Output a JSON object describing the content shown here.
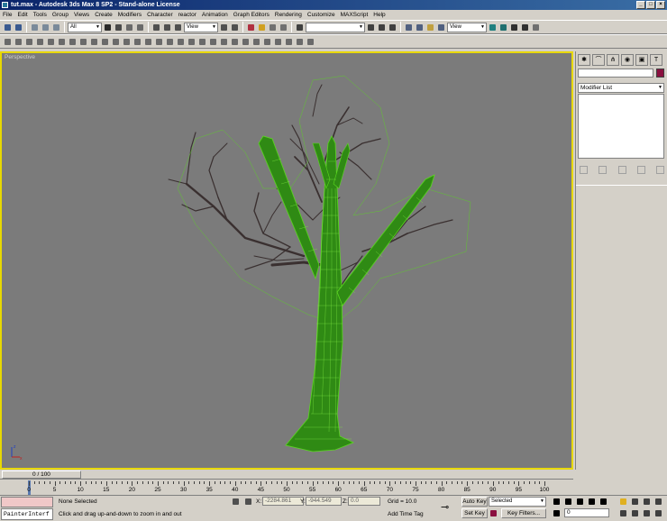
{
  "window": {
    "title": "tut.max - Autodesk 3ds Max 8 SP2 - Stand-alone License"
  },
  "menu": [
    "File",
    "Edit",
    "Tools",
    "Group",
    "Views",
    "Create",
    "Modifiers",
    "Character",
    "reactor",
    "Animation",
    "Graph Editors",
    "Rendering",
    "Customize",
    "MAXScript",
    "Help"
  ],
  "toolbar": {
    "selection_filter": "All",
    "ref_coord": "View",
    "named_sel": "",
    "render_view": "View"
  },
  "viewport": {
    "label": "Perspective",
    "axis_z": "z",
    "axis_x": "x"
  },
  "command_panel": {
    "modifier_list": "Modifier List",
    "color": "#8a1040"
  },
  "timeline": {
    "slider": "0 / 100",
    "ticks": [
      "0",
      "5",
      "10",
      "15",
      "20",
      "25",
      "30",
      "35",
      "40",
      "45",
      "50",
      "55",
      "60",
      "65",
      "70",
      "75",
      "80",
      "85",
      "90",
      "95",
      "100"
    ]
  },
  "status": {
    "maxscript": "PainterInterf",
    "selection": "None Selected",
    "prompt": "Click and drag up-and-down to zoom in and out",
    "x_label": "X:",
    "x_value": "-2284.861",
    "y_label": "Y:",
    "y_value": "-944.549",
    "z_label": "Z:",
    "z_value": "0.0",
    "grid": "Grid = 10.0",
    "add_time_tag": "Add Time Tag",
    "auto_key": "Auto Key",
    "set_key": "Set Key",
    "key_selected": "Selected",
    "key_filters": "Key Filters...",
    "frame": "0"
  },
  "colors": {
    "viewport_bg": "#7b7b7b",
    "viewport_border": "#e8d800",
    "mesh": "#5ad81e",
    "branch": "#3a3030",
    "title_bar": "#0a246a"
  }
}
